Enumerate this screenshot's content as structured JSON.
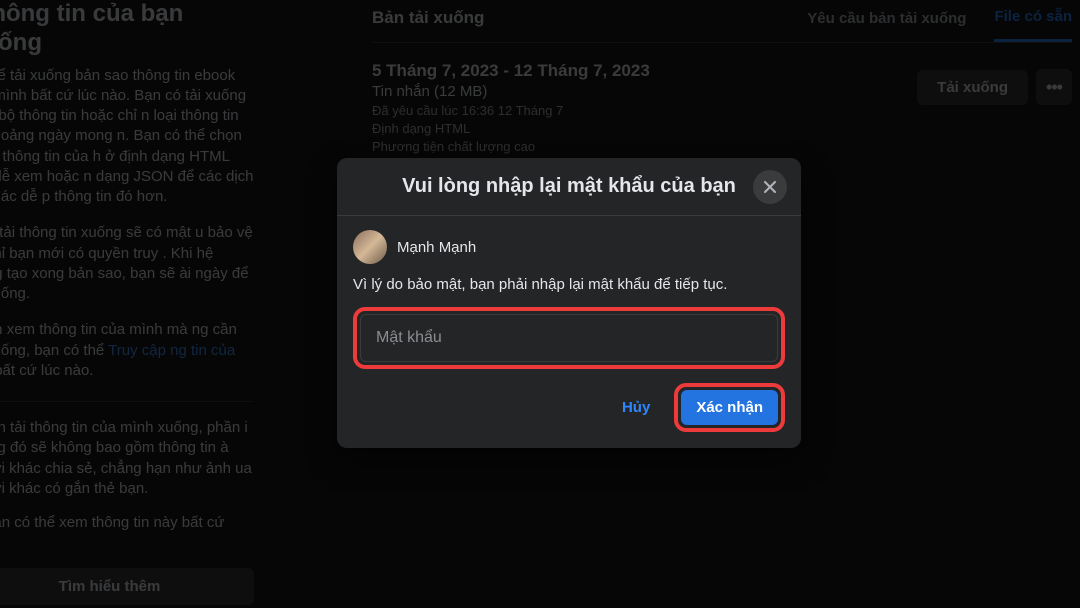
{
  "leftPanel": {
    "title": "i thông tin của bạn xuống",
    "para1": "có thể tải xuống bản sao thông tin ebook của mình bất cứ lúc nào. Bạn có tải xuống toàn bộ thông tin hoặc chỉ n loại thông tin và khoảng ngày mong n. Bạn có thể chọn nhận thông tin của h ở định dạng HTML cho dễ xem hoặc n dạng JSON để các dịch vụ khác dễ p thông tin đó hơn.",
    "para2": "trình tải thông tin xuống sẽ có mật u bảo vệ để chỉ bạn mới có quyền truy . Khi hệ thống tạo xong bản sao, bạn sẽ ài ngày để tải xuống.",
    "para3a": "muốn xem thông tin của mình mà ng cần tải xuống, bạn có thể ",
    "para3link": "Truy cập ng tin của bạn",
    "para3b": " bất cứ lúc nào.",
    "sub1": "hi bạn tải thông tin của mình xuống, phần i xuống đó sẽ không bao gồm thông tin à người khác chia sẻ, chẳng hạn như ảnh ua người khác có gắn thẻ bạn.",
    "sub2": "ạn vẫn có thể xem thông tin này bất cứ nào.",
    "learnMore": "Tìm hiểu thêm"
  },
  "main": {
    "heading": "Bản tải xuống",
    "tab1": "Yêu cầu bản tải xuống",
    "tab2": "File có sẵn",
    "item": {
      "title": "5 Tháng 7, 2023 - 12 Tháng 7, 2023",
      "sub": "Tin nhắn (12 MB)",
      "meta1": "Đã yêu cầu lúc 16:36 12 Tháng 7",
      "meta2": "Định dạng HTML",
      "meta3": "Phương tiện chất lượng cao",
      "dlBtn": "Tải xuống",
      "more": "•••"
    }
  },
  "modal": {
    "title": "Vui lòng nhập lại mật khẩu của bạn",
    "userName": "Mạnh Mạnh",
    "desc": "Vì lý do bảo mật, bạn phải nhập lại mật khẩu để tiếp tục.",
    "placeholder": "Mật khẩu",
    "cancel": "Hủy",
    "confirm": "Xác nhận"
  }
}
